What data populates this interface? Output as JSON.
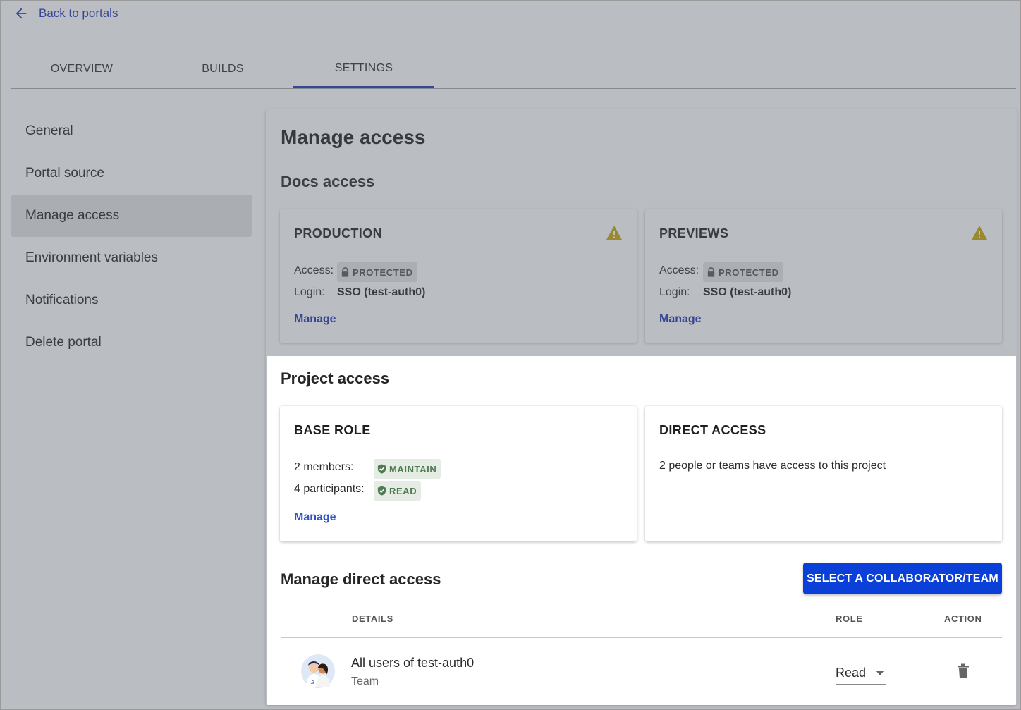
{
  "nav": {
    "back_label": "Back to portals"
  },
  "tabs": [
    {
      "label": "OVERVIEW"
    },
    {
      "label": "BUILDS"
    },
    {
      "label": "SETTINGS",
      "active": true
    }
  ],
  "sidebar": {
    "items": [
      {
        "label": "General"
      },
      {
        "label": "Portal source"
      },
      {
        "label": "Manage access",
        "active": true
      },
      {
        "label": "Environment variables"
      },
      {
        "label": "Notifications"
      },
      {
        "label": "Delete portal"
      }
    ]
  },
  "main": {
    "title": "Manage access",
    "docs_access": {
      "heading": "Docs access",
      "cards": [
        {
          "title": "PRODUCTION",
          "access_label": "Access:",
          "access_badge": "PROTECTED",
          "login_label": "Login:",
          "login_value": "SSO (test-auth0)",
          "manage_label": "Manage",
          "icon": "warning-icon"
        },
        {
          "title": "PREVIEWS",
          "access_label": "Access:",
          "access_badge": "PROTECTED",
          "login_label": "Login:",
          "login_value": "SSO (test-auth0)",
          "manage_label": "Manage",
          "icon": "warning-icon"
        }
      ]
    },
    "project_access": {
      "heading": "Project access",
      "base_role": {
        "title": "BASE ROLE",
        "members_label": "2 members:",
        "members_badge": "MAINTAIN",
        "participants_label": "4 participants:",
        "participants_badge": "READ",
        "manage_label": "Manage"
      },
      "direct_access": {
        "title": "DIRECT ACCESS",
        "text": "2 people or teams have access to this project"
      }
    },
    "manage_direct": {
      "heading": "Manage direct access",
      "button_label": "SELECT A COLLABORATOR/TEAM",
      "columns": {
        "details": "DETAILS",
        "role": "ROLE",
        "action": "ACTION"
      },
      "rows": [
        {
          "name": "All users of test-auth0",
          "type": "Team",
          "role": "Read",
          "avatar": "team-avatar",
          "action_icon": "trash-icon"
        }
      ]
    }
  },
  "colors": {
    "primary": "#0a40d8",
    "link": "#1a2fb5",
    "warning": "#c9a400",
    "role_green": "#4f7a52"
  }
}
